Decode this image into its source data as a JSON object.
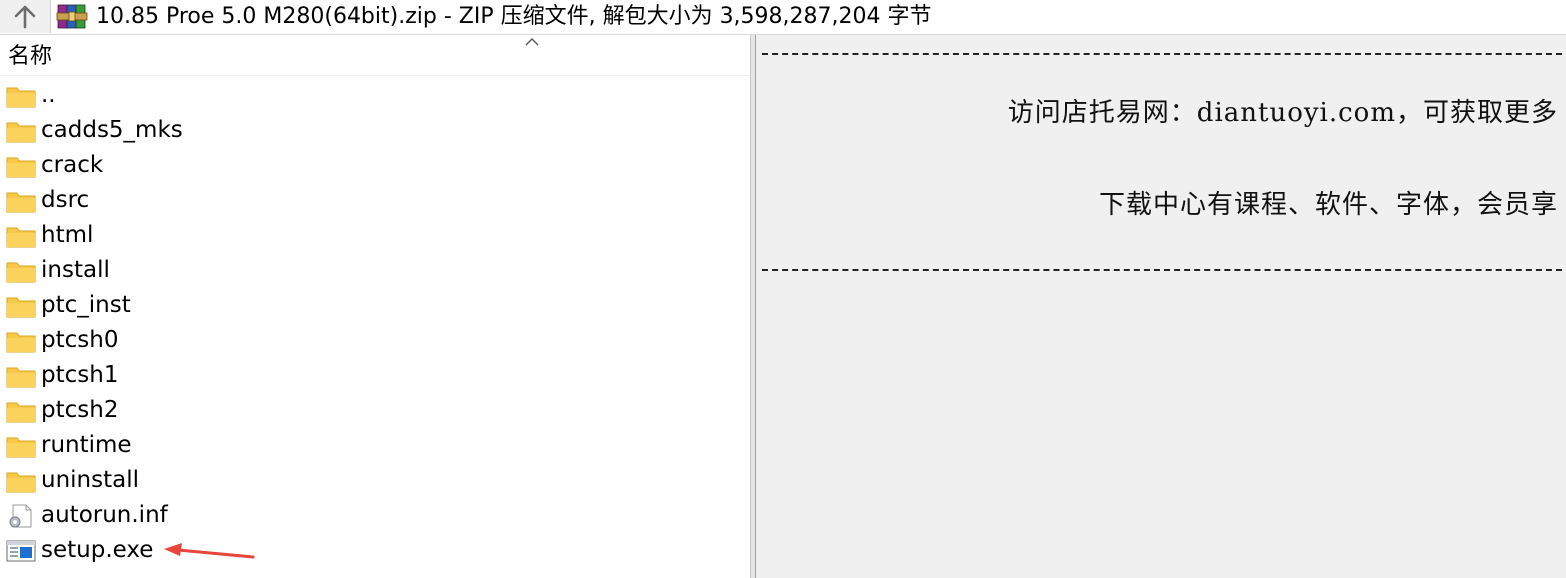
{
  "addressbar": {
    "path": "10.85 Proe 5.0 M280(64bit).zip - ZIP 压缩文件, 解包大小为 3,598,287,204 字节"
  },
  "file_list": {
    "column_header": "名称",
    "items": [
      {
        "name": "..",
        "type": "folder"
      },
      {
        "name": "cadds5_mks",
        "type": "folder"
      },
      {
        "name": "crack",
        "type": "folder"
      },
      {
        "name": "dsrc",
        "type": "folder"
      },
      {
        "name": "html",
        "type": "folder"
      },
      {
        "name": "install",
        "type": "folder"
      },
      {
        "name": "ptc_inst",
        "type": "folder"
      },
      {
        "name": "ptcsh0",
        "type": "folder"
      },
      {
        "name": "ptcsh1",
        "type": "folder"
      },
      {
        "name": "ptcsh2",
        "type": "folder"
      },
      {
        "name": "runtime",
        "type": "folder"
      },
      {
        "name": "uninstall",
        "type": "folder"
      },
      {
        "name": "autorun.inf",
        "type": "settings-file"
      },
      {
        "name": "setup.exe",
        "type": "exe"
      }
    ]
  },
  "comment_pane": {
    "line1": "访问店托易网：diantuoyi.com，可获取更多",
    "line2": "下载中心有课程、软件、字体，会员享"
  },
  "colors": {
    "folder": "#f7c948",
    "annotation_arrow": "#e8453c",
    "comment_bg": "#f0f0f0"
  }
}
